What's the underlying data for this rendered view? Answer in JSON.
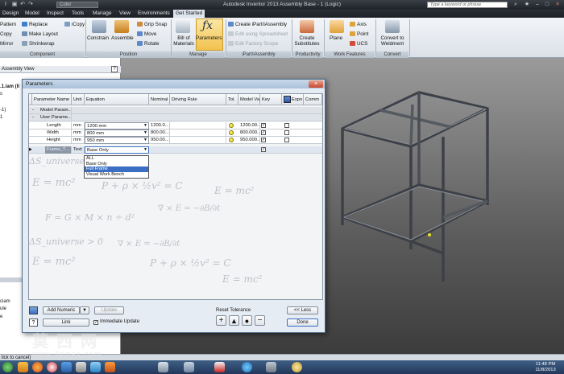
{
  "window": {
    "title": "Autodesk Inventor 2013    Assembly Base - 1 (Logic)",
    "qat_color": "Color",
    "search_placeholder": "Type a keyword or phrase"
  },
  "tabs": [
    "Design",
    "Model",
    "Inspect",
    "Tools",
    "Manage",
    "View",
    "Environments",
    "Get Started"
  ],
  "ribbon": {
    "component_panel": {
      "items": [
        "Pattern",
        "Replace",
        "iCopy",
        "Copy",
        "Make Layout",
        "Mirror",
        "Shrinkwrap"
      ],
      "label": "Component"
    },
    "position_panel": {
      "constrain": "Constrain",
      "assemble": "Assemble",
      "grip_snap": "Grip Snap",
      "move": "Move",
      "rotate": "Rotate",
      "label": "Position"
    },
    "manage_panel": {
      "bill_of_materials": "Bill of Materials",
      "parameters": "Parameters",
      "label": "Manage"
    },
    "ipart_panel": {
      "create": "Create iPart/iAssembly",
      "edit_spreadsheet": "Edit using Spreadsheet",
      "edit_factory": "Edit Factory Scope",
      "label": "iPart/iAssembly"
    },
    "productivity_panel": {
      "create_substitutes": "Create Substitutes",
      "label": "Productivity"
    },
    "work_features_panel": {
      "plane": "Plane",
      "axis": "Axis",
      "point": "Point",
      "ucs": "UCS",
      "label": "Work Features"
    },
    "convert_panel": {
      "convert_to_weldment": "Convert to Weldment",
      "label": "Convert"
    }
  },
  "browser": {
    "header": "Assembly View",
    "items": [
      ".1.iam (Il",
      "s",
      "-1)",
      "1",
      "ciam",
      "ule",
      "e"
    ]
  },
  "dialog": {
    "title": "Parameters",
    "columns": [
      "Parameter Name",
      "Unit",
      "Equation",
      "Nominal",
      "Driving Rule",
      "Tol.",
      "Model Va",
      "Key",
      "Expo",
      "Comm"
    ],
    "group_model": "Model Param...",
    "group_user": "User Parame...",
    "rows": [
      {
        "name": "Length",
        "unit": "mm",
        "equation": "1200 mm",
        "nominal": "1200.0...",
        "model_value": "1200.00..."
      },
      {
        "name": "Width",
        "unit": "mm",
        "equation": "800 mm",
        "nominal": "800.00...",
        "model_value": "800.000..."
      },
      {
        "name": "Height",
        "unit": "mm",
        "equation": "950 mm",
        "nominal": "950.00...",
        "model_value": "950.000..."
      },
      {
        "name": "Frame_T...",
        "unit": "Text",
        "equation": "Base Only"
      }
    ],
    "dropdown_options": [
      "ALL",
      "Base Only",
      "Full Frame",
      "Visual Work Bench"
    ],
    "dropdown_selected_index": 2,
    "background_formulas": [
      "E = mc²",
      "P + ρ × ½v² = C",
      "∇ × E = −∂B/∂t",
      "F = G × M × n ÷ d²",
      "ΔS_universe > 0"
    ],
    "buttons": {
      "add_numeric": "Add Numeric",
      "update": "Update",
      "link": "Link",
      "immediate_update": "Immediate Update",
      "reset_tolerance": "Reset Tolerance",
      "less": "<< Less",
      "done": "Done"
    }
  },
  "status": {
    "text": "lick to cancel)"
  },
  "taskbar": {
    "watermark": "莫西网",
    "site": "www.3dmax.com",
    "clock_time": "11:48 PM",
    "clock_date": "11/8/2013"
  }
}
